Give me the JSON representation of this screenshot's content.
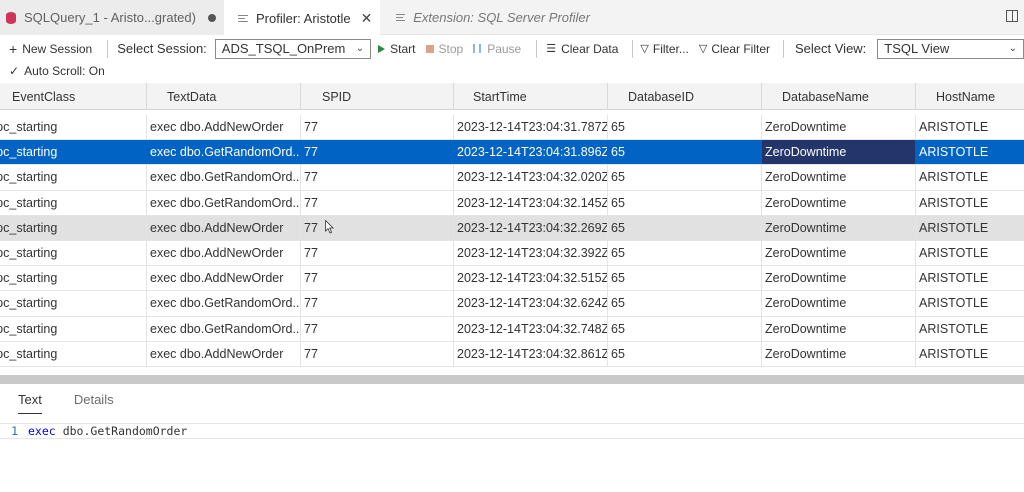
{
  "tabs": [
    {
      "label": "SQLQuery_1 - Aristo...grated)",
      "icon": "database-icon",
      "dirty": true
    },
    {
      "label": "Profiler: Aristotle",
      "icon": "profiler-icon",
      "active": true
    },
    {
      "label": "Extension: SQL Server Profiler",
      "icon": "extension-icon",
      "preview": true
    }
  ],
  "toolbar": {
    "new_session": "New Session",
    "select_session_label": "Select Session:",
    "session_value": "ADS_TSQL_OnPrem",
    "start": "Start",
    "stop": "Stop",
    "pause": "Pause",
    "clear_data": "Clear Data",
    "filter": "Filter...",
    "clear_filter": "Clear Filter",
    "select_view_label": "Select View:",
    "view_value": "TSQL View",
    "auto_scroll": "Auto Scroll: On"
  },
  "grid": {
    "columns": [
      "EventClass",
      "TextData",
      "SPID",
      "StartTime",
      "DatabaseID",
      "DatabaseName",
      "HostName"
    ],
    "rows": [
      [
        "rpc_starting",
        "exec dbo.AddNewOrder",
        "77",
        "2023-12-14T23:04:31.787Z",
        "65",
        "ZeroDowntime",
        "ARISTOTLE"
      ],
      [
        "rpc_starting",
        "exec dbo.GetRandomOrd...",
        "77",
        "2023-12-14T23:04:31.896Z",
        "65",
        "ZeroDowntime",
        "ARISTOTLE"
      ],
      [
        "rpc_starting",
        "exec dbo.GetRandomOrd...",
        "77",
        "2023-12-14T23:04:32.020Z",
        "65",
        "ZeroDowntime",
        "ARISTOTLE"
      ],
      [
        "rpc_starting",
        "exec dbo.GetRandomOrd...",
        "77",
        "2023-12-14T23:04:32.145Z",
        "65",
        "ZeroDowntime",
        "ARISTOTLE"
      ],
      [
        "rpc_starting",
        "exec dbo.AddNewOrder",
        "77",
        "2023-12-14T23:04:32.269Z",
        "65",
        "ZeroDowntime",
        "ARISTOTLE"
      ],
      [
        "rpc_starting",
        "exec dbo.AddNewOrder",
        "77",
        "2023-12-14T23:04:32.392Z",
        "65",
        "ZeroDowntime",
        "ARISTOTLE"
      ],
      [
        "rpc_starting",
        "exec dbo.AddNewOrder",
        "77",
        "2023-12-14T23:04:32.515Z",
        "65",
        "ZeroDowntime",
        "ARISTOTLE"
      ],
      [
        "rpc_starting",
        "exec dbo.GetRandomOrd...",
        "77",
        "2023-12-14T23:04:32.624Z",
        "65",
        "ZeroDowntime",
        "ARISTOTLE"
      ],
      [
        "rpc_starting",
        "exec dbo.GetRandomOrd...",
        "77",
        "2023-12-14T23:04:32.748Z",
        "65",
        "ZeroDowntime",
        "ARISTOTLE"
      ],
      [
        "rpc_starting",
        "exec dbo.AddNewOrder",
        "77",
        "2023-12-14T23:04:32.861Z",
        "65",
        "ZeroDowntime",
        "ARISTOTLE"
      ]
    ]
  },
  "details": {
    "tabs": [
      "Text",
      "Details"
    ],
    "line_number": "1",
    "keyword": "exec",
    "code": "dbo.GetRandomOrder"
  },
  "colors": {
    "selection": "#0163c4",
    "focused_cell": "#23356a",
    "hover_row": "#e1e1e1"
  }
}
